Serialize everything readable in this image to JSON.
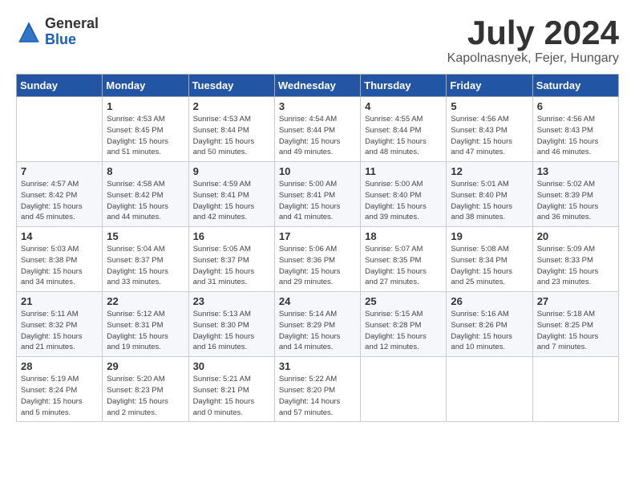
{
  "logo": {
    "general": "General",
    "blue": "Blue"
  },
  "title": "July 2024",
  "location": "Kapolnasnyek, Fejer, Hungary",
  "headers": [
    "Sunday",
    "Monday",
    "Tuesday",
    "Wednesday",
    "Thursday",
    "Friday",
    "Saturday"
  ],
  "weeks": [
    [
      {
        "day": "",
        "info": ""
      },
      {
        "day": "1",
        "info": "Sunrise: 4:53 AM\nSunset: 8:45 PM\nDaylight: 15 hours\nand 51 minutes."
      },
      {
        "day": "2",
        "info": "Sunrise: 4:53 AM\nSunset: 8:44 PM\nDaylight: 15 hours\nand 50 minutes."
      },
      {
        "day": "3",
        "info": "Sunrise: 4:54 AM\nSunset: 8:44 PM\nDaylight: 15 hours\nand 49 minutes."
      },
      {
        "day": "4",
        "info": "Sunrise: 4:55 AM\nSunset: 8:44 PM\nDaylight: 15 hours\nand 48 minutes."
      },
      {
        "day": "5",
        "info": "Sunrise: 4:56 AM\nSunset: 8:43 PM\nDaylight: 15 hours\nand 47 minutes."
      },
      {
        "day": "6",
        "info": "Sunrise: 4:56 AM\nSunset: 8:43 PM\nDaylight: 15 hours\nand 46 minutes."
      }
    ],
    [
      {
        "day": "7",
        "info": "Sunrise: 4:57 AM\nSunset: 8:42 PM\nDaylight: 15 hours\nand 45 minutes."
      },
      {
        "day": "8",
        "info": "Sunrise: 4:58 AM\nSunset: 8:42 PM\nDaylight: 15 hours\nand 44 minutes."
      },
      {
        "day": "9",
        "info": "Sunrise: 4:59 AM\nSunset: 8:41 PM\nDaylight: 15 hours\nand 42 minutes."
      },
      {
        "day": "10",
        "info": "Sunrise: 5:00 AM\nSunset: 8:41 PM\nDaylight: 15 hours\nand 41 minutes."
      },
      {
        "day": "11",
        "info": "Sunrise: 5:00 AM\nSunset: 8:40 PM\nDaylight: 15 hours\nand 39 minutes."
      },
      {
        "day": "12",
        "info": "Sunrise: 5:01 AM\nSunset: 8:40 PM\nDaylight: 15 hours\nand 38 minutes."
      },
      {
        "day": "13",
        "info": "Sunrise: 5:02 AM\nSunset: 8:39 PM\nDaylight: 15 hours\nand 36 minutes."
      }
    ],
    [
      {
        "day": "14",
        "info": "Sunrise: 5:03 AM\nSunset: 8:38 PM\nDaylight: 15 hours\nand 34 minutes."
      },
      {
        "day": "15",
        "info": "Sunrise: 5:04 AM\nSunset: 8:37 PM\nDaylight: 15 hours\nand 33 minutes."
      },
      {
        "day": "16",
        "info": "Sunrise: 5:05 AM\nSunset: 8:37 PM\nDaylight: 15 hours\nand 31 minutes."
      },
      {
        "day": "17",
        "info": "Sunrise: 5:06 AM\nSunset: 8:36 PM\nDaylight: 15 hours\nand 29 minutes."
      },
      {
        "day": "18",
        "info": "Sunrise: 5:07 AM\nSunset: 8:35 PM\nDaylight: 15 hours\nand 27 minutes."
      },
      {
        "day": "19",
        "info": "Sunrise: 5:08 AM\nSunset: 8:34 PM\nDaylight: 15 hours\nand 25 minutes."
      },
      {
        "day": "20",
        "info": "Sunrise: 5:09 AM\nSunset: 8:33 PM\nDaylight: 15 hours\nand 23 minutes."
      }
    ],
    [
      {
        "day": "21",
        "info": "Sunrise: 5:11 AM\nSunset: 8:32 PM\nDaylight: 15 hours\nand 21 minutes."
      },
      {
        "day": "22",
        "info": "Sunrise: 5:12 AM\nSunset: 8:31 PM\nDaylight: 15 hours\nand 19 minutes."
      },
      {
        "day": "23",
        "info": "Sunrise: 5:13 AM\nSunset: 8:30 PM\nDaylight: 15 hours\nand 16 minutes."
      },
      {
        "day": "24",
        "info": "Sunrise: 5:14 AM\nSunset: 8:29 PM\nDaylight: 15 hours\nand 14 minutes."
      },
      {
        "day": "25",
        "info": "Sunrise: 5:15 AM\nSunset: 8:28 PM\nDaylight: 15 hours\nand 12 minutes."
      },
      {
        "day": "26",
        "info": "Sunrise: 5:16 AM\nSunset: 8:26 PM\nDaylight: 15 hours\nand 10 minutes."
      },
      {
        "day": "27",
        "info": "Sunrise: 5:18 AM\nSunset: 8:25 PM\nDaylight: 15 hours\nand 7 minutes."
      }
    ],
    [
      {
        "day": "28",
        "info": "Sunrise: 5:19 AM\nSunset: 8:24 PM\nDaylight: 15 hours\nand 5 minutes."
      },
      {
        "day": "29",
        "info": "Sunrise: 5:20 AM\nSunset: 8:23 PM\nDaylight: 15 hours\nand 2 minutes."
      },
      {
        "day": "30",
        "info": "Sunrise: 5:21 AM\nSunset: 8:21 PM\nDaylight: 15 hours\nand 0 minutes."
      },
      {
        "day": "31",
        "info": "Sunrise: 5:22 AM\nSunset: 8:20 PM\nDaylight: 14 hours\nand 57 minutes."
      },
      {
        "day": "",
        "info": ""
      },
      {
        "day": "",
        "info": ""
      },
      {
        "day": "",
        "info": ""
      }
    ]
  ]
}
